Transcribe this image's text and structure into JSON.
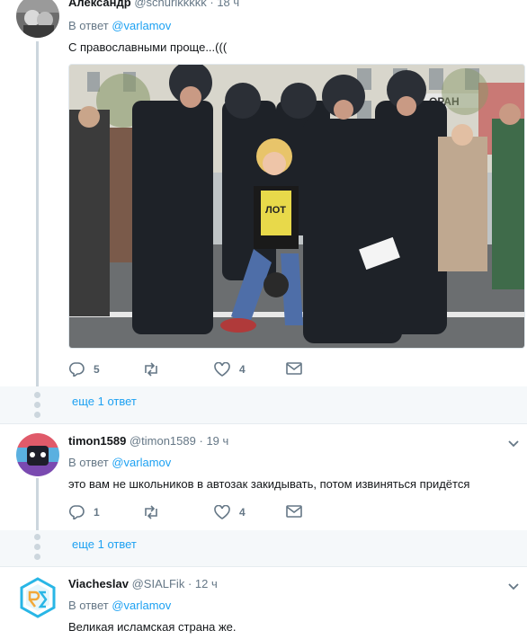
{
  "tweets": [
    {
      "name": "Александр",
      "handle": "@schurikkkkk",
      "time": "18 ч",
      "reply_label": "В ответ",
      "reply_mention": "@varlamov",
      "text": "С православными проще...(((",
      "replies": "5",
      "retweets": "",
      "likes": "4",
      "more_label": "еще 1 ответ"
    },
    {
      "name": "timon1589",
      "handle": "@timon1589",
      "time": "19 ч",
      "reply_label": "В ответ",
      "reply_mention": "@varlamov",
      "text": "это вам не школьников в автозак закидывать, потом извиняться придётся",
      "replies": "1",
      "retweets": "",
      "likes": "4",
      "more_label": "еще 1 ответ"
    },
    {
      "name": "Viacheslav",
      "handle": "@SIALFik",
      "time": "12 ч",
      "reply_label": "В ответ",
      "reply_mention": "@varlamov",
      "text": "Великая исламская страна же."
    }
  ],
  "separator_dot": "·",
  "photo_text": {
    "shirt": "ЛОТ",
    "sign": "ОРАН"
  },
  "colors": {
    "accent": "#1da1f2",
    "muted": "#657786",
    "line": "#ccd6dd"
  },
  "icons": [
    "reply-icon",
    "retweet-icon",
    "like-icon",
    "dm-icon",
    "chevron-down-icon"
  ]
}
